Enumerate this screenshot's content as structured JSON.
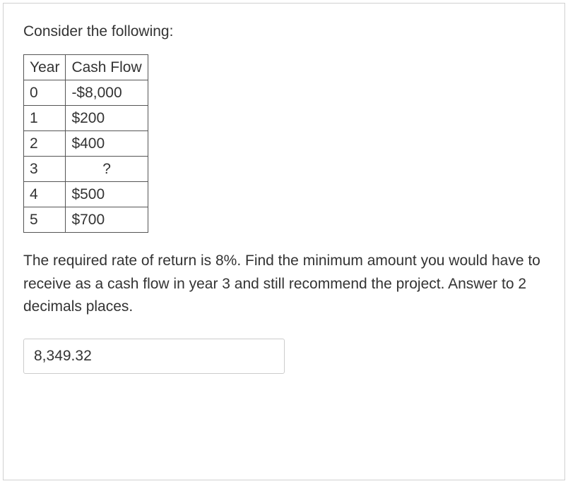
{
  "intro": "Consider the following:",
  "table": {
    "headers": [
      "Year",
      "Cash Flow"
    ],
    "rows": [
      {
        "year": "0",
        "cash": "-$8,000"
      },
      {
        "year": "1",
        "cash": "$200"
      },
      {
        "year": "2",
        "cash": "$400"
      },
      {
        "year": "3",
        "cash": "?"
      },
      {
        "year": "4",
        "cash": "$500"
      },
      {
        "year": "5",
        "cash": "$700"
      }
    ]
  },
  "question": "The required rate of return is 8%. Find the minimum amount you would have to receive as a cash flow in year 3 and still recommend the project. Answer to 2 decimals places.",
  "answer_value": "8,349.32"
}
